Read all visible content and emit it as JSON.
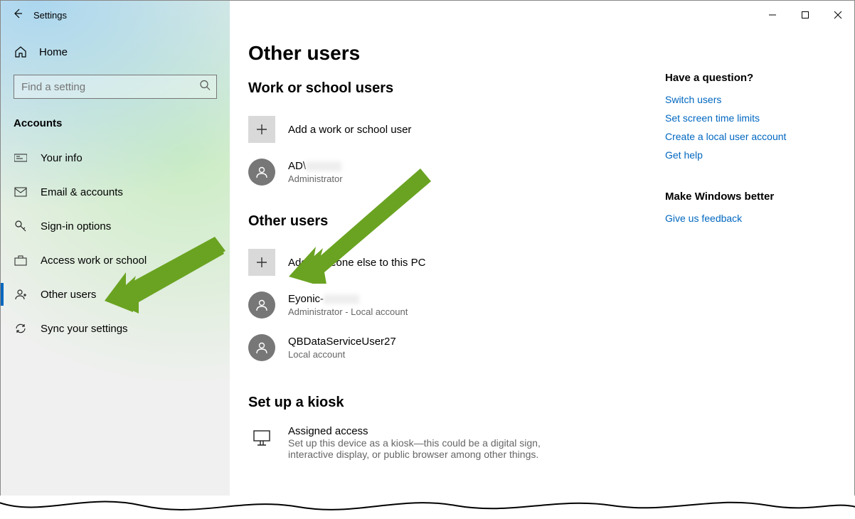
{
  "titlebar": {
    "title": "Settings"
  },
  "sidebar": {
    "home_label": "Home",
    "search_placeholder": "Find a setting",
    "section": "Accounts",
    "items": [
      {
        "label": "Your info"
      },
      {
        "label": "Email & accounts"
      },
      {
        "label": "Sign-in options"
      },
      {
        "label": "Access work or school"
      },
      {
        "label": "Other users"
      },
      {
        "label": "Sync your settings"
      }
    ]
  },
  "page": {
    "title": "Other users",
    "work_section": {
      "heading": "Work or school users",
      "add_label": "Add a work or school user",
      "users": [
        {
          "name": "AD\\",
          "role": "Administrator"
        }
      ]
    },
    "other_section": {
      "heading": "Other users",
      "add_label": "Add someone else to this PC",
      "users": [
        {
          "name": "Eyonic-",
          "role": "Administrator - Local account"
        },
        {
          "name": "QBDataServiceUser27",
          "role": "Local account"
        }
      ]
    },
    "kiosk_section": {
      "heading": "Set up a kiosk",
      "title": "Assigned access",
      "desc": "Set up this device as a kiosk—this could be a digital sign, interactive display, or public browser among other things."
    }
  },
  "right": {
    "question_heading": "Have a question?",
    "links": [
      "Switch users",
      "Set screen time limits",
      "Create a local user account",
      "Get help"
    ],
    "improve_heading": "Make Windows better",
    "feedback_link": "Give us feedback"
  }
}
